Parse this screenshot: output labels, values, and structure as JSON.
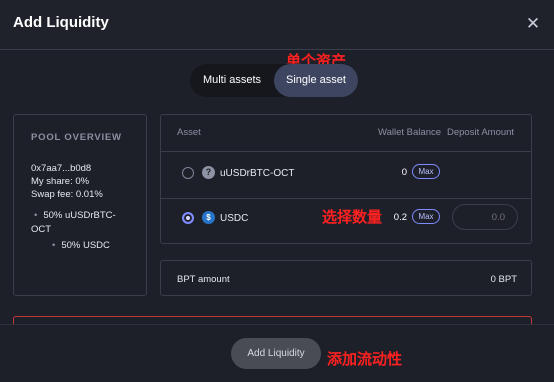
{
  "modal": {
    "title": "Add Liquidity",
    "close_glyph": "✕"
  },
  "annotations": {
    "single_asset": "单个资产",
    "select_amount": "选择数量",
    "add_liquidity": "添加流动性"
  },
  "tabs": [
    {
      "label": "Multi assets",
      "active": false
    },
    {
      "label": "Single asset",
      "active": true
    }
  ],
  "pool_overview": {
    "title": "POOL OVERVIEW",
    "address": "0x7aa7...b0d8",
    "share": "My share: 0%",
    "swap_fee": "Swap fee: 0.01%",
    "composition_1a": "50% uUSDrBTC-",
    "composition_1b": "OCT",
    "composition_2": "50% USDC"
  },
  "assets_table": {
    "headers": {
      "asset": "Asset",
      "wallet_balance": "Wallet Balance",
      "deposit_amount": "Deposit Amount"
    },
    "rows": [
      {
        "selected": false,
        "icon": "question-token-icon",
        "name": "uUSDrBTC-OCT",
        "balance": "0",
        "max_label": "Max"
      },
      {
        "selected": true,
        "icon": "usdc-token-icon",
        "name": "USDC",
        "balance": "0.2",
        "max_label": "Max",
        "amount_placeholder": "0.0"
      }
    ]
  },
  "bpt": {
    "label": "BPT amount",
    "value": "0 BPT"
  },
  "footer": {
    "add_button": "Add Liquidity"
  },
  "colors": {
    "background": "#1e2029",
    "border": "#3a3e4c",
    "accent": "#7e8bff",
    "annotation": "#ff2020"
  }
}
